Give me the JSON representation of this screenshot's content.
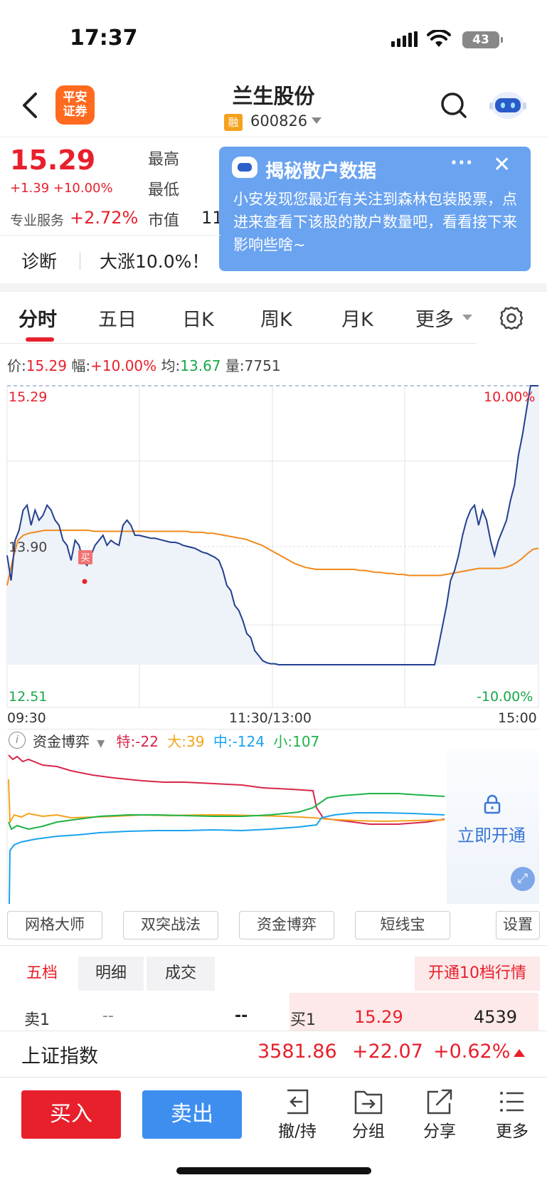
{
  "status_bar": {
    "time": "17:37",
    "battery": "43"
  },
  "header": {
    "logo_text": "平安证券",
    "stock_name": "兰生股份",
    "badge": "融",
    "code": "600826"
  },
  "quote": {
    "price": "15.29",
    "change": "+1.39 +10.00%",
    "pro_label": "专业服务",
    "pro_value": "+2.72%",
    "high_label": "最高",
    "low_label": "最低",
    "mktcap_label": "市值",
    "mktcap_value_partial": "11"
  },
  "popup": {
    "title": "揭秘散户数据",
    "body": "小安发现您最近有关注到森林包装股票，点进来查看下该股的散户数量吧，看看接下来影响些啥~",
    "more": "···",
    "close": "✕"
  },
  "diagnosis": {
    "label": "诊断",
    "text": "大涨10.0%！"
  },
  "tabs": [
    "分时",
    "五日",
    "日K",
    "周K",
    "月K",
    "更多"
  ],
  "info": {
    "price_label": "价:",
    "price": "15.29",
    "amp_label": "幅:",
    "amp": "+10.00%",
    "avg_label": "均:",
    "avg": "13.67",
    "vol_label": "量:",
    "vol": "7751"
  },
  "chart_data": {
    "type": "line",
    "title": "",
    "y_axis_labels": {
      "top": "15.29",
      "mid": "13.90",
      "bottom": "12.51"
    },
    "pct_labels": {
      "top": "10.00%",
      "bottom": "-10.00%"
    },
    "x_labels": [
      "09:30",
      "11:30/13:00",
      "15:00"
    ],
    "ylim": [
      12.51,
      15.29
    ],
    "buy_marker": "买",
    "series": [
      {
        "name": "",
        "color": "#23408f",
        "values": [
          13.6,
          13.35,
          13.75,
          13.85,
          14.05,
          14.1,
          13.9,
          14.05,
          13.95,
          14.0,
          14.1,
          14.05,
          13.95,
          13.9,
          13.75,
          13.7,
          13.55,
          13.75,
          13.7,
          13.55,
          13.5,
          13.6,
          13.7,
          13.75,
          13.8,
          13.7,
          13.75,
          13.72,
          13.7,
          13.9,
          13.95,
          13.9,
          13.8,
          13.8,
          13.79,
          13.78,
          13.77,
          13.77,
          13.76,
          13.75,
          13.74,
          13.73,
          13.73,
          13.72,
          13.7,
          13.69,
          13.68,
          13.67,
          13.65,
          13.63,
          13.62,
          13.6,
          13.58,
          13.55,
          13.45,
          13.3,
          13.25,
          13.1,
          13.05,
          12.95,
          12.82,
          12.78,
          12.65,
          12.6,
          12.55,
          12.53,
          12.52,
          12.52,
          12.51,
          12.51,
          12.51,
          12.51,
          12.51,
          12.51,
          12.51,
          12.51,
          12.51,
          12.51,
          12.51,
          12.51,
          12.51,
          12.51,
          12.51,
          12.51,
          12.51,
          12.51,
          12.51,
          12.51,
          12.51,
          12.51,
          12.51,
          12.51,
          12.51,
          12.51,
          12.51,
          12.51,
          12.51,
          12.51,
          12.51,
          12.51,
          12.51,
          12.51,
          12.51,
          12.51,
          12.51,
          12.51,
          12.51,
          12.51,
          12.7,
          12.9,
          13.1,
          13.35,
          13.45,
          13.6,
          13.8,
          13.95,
          14.05,
          14.1,
          13.9,
          14.05,
          13.95,
          13.75,
          13.6,
          13.75,
          13.85,
          13.95,
          14.15,
          14.3,
          14.6,
          14.8,
          15.05,
          15.29,
          15.29,
          15.29
        ]
      },
      {
        "name": "",
        "color": "#f08a1c",
        "values": [
          13.3,
          13.55,
          13.75,
          13.8,
          13.82,
          13.83,
          13.84,
          13.85,
          13.85,
          13.85,
          13.85,
          13.85,
          13.85,
          13.85,
          13.85,
          13.85,
          13.84,
          13.84,
          13.84,
          13.84,
          13.84,
          13.84,
          13.84,
          13.84,
          13.84,
          13.84,
          13.84,
          13.84,
          13.84,
          13.84,
          13.84,
          13.84,
          13.84,
          13.84,
          13.83,
          13.83,
          13.83,
          13.82,
          13.82,
          13.81,
          13.8,
          13.79,
          13.78,
          13.77,
          13.76,
          13.74,
          13.72,
          13.7,
          13.67,
          13.64,
          13.61,
          13.58,
          13.55,
          13.52,
          13.5,
          13.48,
          13.47,
          13.46,
          13.46,
          13.46,
          13.46,
          13.46,
          13.46,
          13.46,
          13.46,
          13.45,
          13.45,
          13.44,
          13.43,
          13.43,
          13.42,
          13.42,
          13.41,
          13.41,
          13.4,
          13.4,
          13.4,
          13.4,
          13.4,
          13.4,
          13.4,
          13.41,
          13.42,
          13.43,
          13.44,
          13.45,
          13.46,
          13.47,
          13.47,
          13.47,
          13.47,
          13.47,
          13.48,
          13.5,
          13.53,
          13.57,
          13.62,
          13.66,
          13.67
        ]
      }
    ]
  },
  "capital": {
    "title": "资金博弈",
    "te_label": "特:",
    "te": "-22",
    "da_label": "大:",
    "da": "39",
    "zhong_label": "中:",
    "zhong": "-124",
    "xiao_label": "小:",
    "xiao": "107",
    "unlock": "立即开通",
    "colors": {
      "te": "#d8274a",
      "da": "#f4a21b",
      "zhong": "#1ba3ef",
      "xiao": "#1fb34a"
    }
  },
  "tools": [
    "网格大师",
    "双突战法",
    "资金博弈",
    "短线宝",
    "设置"
  ],
  "orderbook": {
    "tabs": [
      "五档",
      "明细",
      "成交"
    ],
    "upgrade": "开通10档行情",
    "sell1_label": "卖1",
    "sell1_price": "--",
    "sell1_vol": "--",
    "buy1_label": "买1",
    "buy1_price": "15.29",
    "buy1_vol": "4539"
  },
  "index": {
    "name": "上证指数",
    "value": "3581.86",
    "change": "+22.07",
    "pct": "+0.62%"
  },
  "actions": {
    "buy": "买入",
    "sell": "卖出",
    "items": [
      "撤/持",
      "分组",
      "分享",
      "更多"
    ]
  }
}
